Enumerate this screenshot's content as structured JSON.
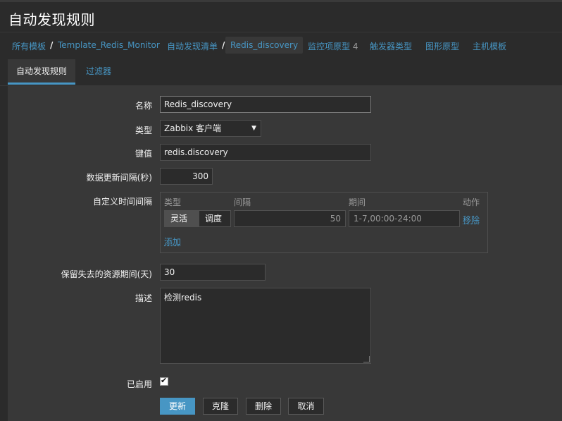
{
  "page": {
    "title": "自动发现规则"
  },
  "breadcrumb": {
    "all_templates": "所有模板",
    "template": "Template_Redis_Monitor",
    "discovery_list": "自动发现清单",
    "current": "Redis_discovery",
    "item_prototypes": "监控项原型",
    "item_prototypes_count": "4",
    "trigger_prototypes": "触发器类型",
    "graph_prototypes": "图形原型",
    "host_prototypes": "主机模板",
    "separator": "/"
  },
  "tabs": {
    "discovery_rule": "自动发现规则",
    "filters": "过滤器"
  },
  "form": {
    "name_label": "名称",
    "name_value": "Redis_discovery",
    "type_label": "类型",
    "type_value": "Zabbix 客户端",
    "type_arrow": "▼",
    "key_label": "键值",
    "key_value": "redis.discovery",
    "interval_label": "数据更新间隔(秒)",
    "interval_value": "300",
    "custom_intervals_label": "自定义时间间隔",
    "custom_intervals": {
      "col_type": "类型",
      "col_interval": "间隔",
      "col_period": "期间",
      "col_action": "动作",
      "row": {
        "flexible": "灵活",
        "scheduling": "调度",
        "interval": "50",
        "period": "1-7,00:00-24:00",
        "remove": "移除"
      },
      "add": "添加"
    },
    "lifetime_label": "保留失去的资源期间(天)",
    "lifetime_value": "30",
    "description_label": "描述",
    "description_value": "检测redis",
    "enabled_label": "已启用",
    "enabled_checked": true
  },
  "buttons": {
    "update": "更新",
    "clone": "克隆",
    "delete": "删除",
    "cancel": "取消"
  },
  "colors": {
    "accent": "#4796c4",
    "background": "#2b2b2b",
    "panel": "#383838"
  }
}
